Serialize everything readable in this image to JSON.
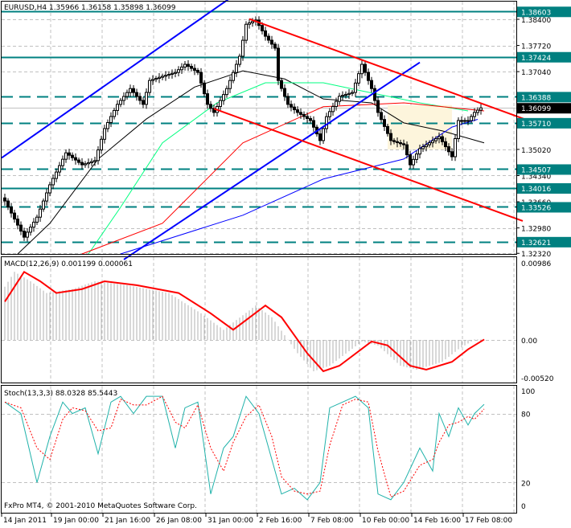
{
  "header": {
    "title": "EURUSD,H4  1.35966 1.36158 1.35898 1.36099"
  },
  "footer": {
    "copyright": "FxPro MT4, © 2001-2010 MetaQuotes Software Corp."
  },
  "colors": {
    "level": "#008080",
    "channel_blue": "#0000ff",
    "channel_red": "#ff0000",
    "ma_black": "#000000",
    "ma_green": "#00ff80",
    "ma_red": "#ff0000",
    "ma_blue": "#0000ff",
    "highlight": "#fdf5dc",
    "grid": "#c0c0c0"
  },
  "chart_data": [
    {
      "type": "candlestick",
      "title": "EURUSD,H4",
      "ohlc_last": {
        "open": 1.35966,
        "high": 1.36158,
        "low": 1.35898,
        "close": 1.36099
      },
      "ylim": [
        1.3215,
        1.388
      ],
      "y_ticks": [
        "1.38400",
        "1.37720",
        "1.37040",
        "1.35020",
        "1.34340",
        "1.33660",
        "1.32980",
        "1.32320"
      ],
      "x_ticks": [
        {
          "bar": 0,
          "label": "14 Jan 2011"
        },
        {
          "bar": 16,
          "label": "19 Jan 00:00"
        },
        {
          "bar": 32,
          "label": "21 Jan 16:00"
        },
        {
          "bar": 48,
          "label": "26 Jan 08:00"
        },
        {
          "bar": 64,
          "label": "31 Jan 00:00"
        },
        {
          "bar": 80,
          "label": "2 Feb 16:00"
        },
        {
          "bar": 96,
          "label": "7 Feb 08:00"
        },
        {
          "bar": 112,
          "label": "10 Feb 00:00"
        },
        {
          "bar": 128,
          "label": "14 Feb 16:00"
        },
        {
          "bar": 144,
          "label": "17 Feb 08:00"
        }
      ],
      "close_keypoints": [
        [
          1,
          1.3368
        ],
        [
          7,
          1.3274
        ],
        [
          11,
          1.3326
        ],
        [
          15,
          1.341
        ],
        [
          20,
          1.3493
        ],
        [
          25,
          1.3462
        ],
        [
          29,
          1.3473
        ],
        [
          32,
          1.3556
        ],
        [
          36,
          1.3619
        ],
        [
          40,
          1.366
        ],
        [
          44,
          1.3619
        ],
        [
          46,
          1.3681
        ],
        [
          50,
          1.3692
        ],
        [
          54,
          1.3702
        ],
        [
          57,
          1.3723
        ],
        [
          61,
          1.3702
        ],
        [
          64,
          1.3619
        ],
        [
          66,
          1.3598
        ],
        [
          70,
          1.366
        ],
        [
          74,
          1.3744
        ],
        [
          76,
          1.3827
        ],
        [
          79,
          1.3838
        ],
        [
          82,
          1.3796
        ],
        [
          85,
          1.3765
        ],
        [
          86,
          1.3681
        ],
        [
          89,
          1.3619
        ],
        [
          92,
          1.3598
        ],
        [
          96,
          1.3577
        ],
        [
          99,
          1.3525
        ],
        [
          101,
          1.3587
        ],
        [
          105,
          1.364
        ],
        [
          109,
          1.365
        ],
        [
          112,
          1.3723
        ],
        [
          115,
          1.366
        ],
        [
          117,
          1.3598
        ],
        [
          121,
          1.3525
        ],
        [
          125,
          1.3514
        ],
        [
          127,
          1.3462
        ],
        [
          130,
          1.3504
        ],
        [
          132,
          1.3514
        ],
        [
          136,
          1.3535
        ],
        [
          140,
          1.3483
        ],
        [
          142,
          1.3577
        ],
        [
          145,
          1.3577
        ],
        [
          147,
          1.3598
        ],
        [
          149,
          1.36099
        ]
      ],
      "levels": [
        {
          "price": "1.38603",
          "style": "solid"
        },
        {
          "price": "1.37424",
          "style": "solid"
        },
        {
          "price": "1.36388",
          "style": "dashed"
        },
        {
          "price": "1.35710",
          "style": "dashed"
        },
        {
          "price": "1.34507",
          "style": "dashed"
        },
        {
          "price": "1.34016",
          "style": "solid"
        },
        {
          "price": "1.33526",
          "style": "dashed"
        },
        {
          "price": "1.32621",
          "style": "dashed"
        }
      ],
      "current_price": "1.36099",
      "moving_averages": [
        {
          "name": "MA black",
          "color": "#000000",
          "points": [
            [
              5,
              1.3216
            ],
            [
              15,
              1.331
            ],
            [
              30,
              1.3477
            ],
            [
              45,
              1.3581
            ],
            [
              60,
              1.3664
            ],
            [
              75,
              1.3706
            ],
            [
              88,
              1.3685
            ],
            [
              100,
              1.3633
            ],
            [
              115,
              1.3623
            ],
            [
              125,
              1.3571
            ],
            [
              137,
              1.355
            ],
            [
              150,
              1.3519
            ]
          ]
        },
        {
          "name": "MA green",
          "color": "#00ff80",
          "points": [
            [
              27,
              1.3216
            ],
            [
              37,
              1.3352
            ],
            [
              50,
              1.3519
            ],
            [
              67,
              1.3623
            ],
            [
              82,
              1.3675
            ],
            [
              100,
              1.3675
            ],
            [
              112,
              1.3654
            ],
            [
              130,
              1.3623
            ],
            [
              145,
              1.3602
            ]
          ]
        },
        {
          "name": "MA red",
          "color": "#ff0000",
          "points": [
            [
              25,
              1.3216
            ],
            [
              50,
              1.331
            ],
            [
              75,
              1.3519
            ],
            [
              100,
              1.3613
            ],
            [
              125,
              1.3623
            ],
            [
              150,
              1.3602
            ]
          ]
        },
        {
          "name": "MA blue",
          "color": "#0000ff",
          "points": [
            [
              37,
              1.3216
            ],
            [
              75,
              1.3331
            ],
            [
              100,
              1.3425
            ],
            [
              125,
              1.3477
            ],
            [
              140,
              1.356
            ],
            [
              148,
              1.358
            ]
          ]
        }
      ],
      "trendlines": [
        {
          "name": "blue-channel-upper",
          "color": "#0000ff",
          "from": [
            0,
            1.348
          ],
          "to": [
            77,
            1.393
          ]
        },
        {
          "name": "blue-channel-lower",
          "color": "#0000ff",
          "from": [
            38,
            1.3216
          ],
          "to": [
            130,
            1.3728
          ]
        },
        {
          "name": "red-channel-upper",
          "color": "#ff0000",
          "from": [
            77,
            1.3841
          ],
          "to": [
            168,
            1.3564
          ]
        },
        {
          "name": "red-channel-lower",
          "color": "#ff0000",
          "from": [
            66,
            1.3608
          ],
          "to": [
            162,
            1.3316
          ]
        }
      ],
      "highlight_box": {
        "from_bar": 120,
        "to_bar": 140,
        "high": 1.3617,
        "low": 1.3502
      }
    },
    {
      "type": "line",
      "title": "MACD(12,26,9) 0.001199 0.000061",
      "ylim": [
        -0.0052,
        0.00986
      ],
      "y_ticks": [
        "0.00986",
        "0.00",
        "-0.00520"
      ],
      "signal_points": [
        [
          1,
          0.0049
        ],
        [
          7,
          0.0087
        ],
        [
          12,
          0.0075
        ],
        [
          17,
          0.006
        ],
        [
          25,
          0.0065
        ],
        [
          32,
          0.0075
        ],
        [
          42,
          0.007
        ],
        [
          55,
          0.006
        ],
        [
          65,
          0.0034
        ],
        [
          72,
          0.0013
        ],
        [
          82,
          0.0044
        ],
        [
          87,
          0.0029
        ],
        [
          95,
          -0.0017
        ],
        [
          100,
          -0.004
        ],
        [
          105,
          -0.0033
        ],
        [
          115,
          -0.0002
        ],
        [
          120,
          -0.0007
        ],
        [
          127,
          -0.0033
        ],
        [
          132,
          -0.0038
        ],
        [
          140,
          -0.0028
        ],
        [
          145,
          -0.0012
        ],
        [
          150,
          6e-05
        ]
      ]
    },
    {
      "type": "line",
      "title": "Stoch(13,3,3) 88.0328 85.5443",
      "ylim": [
        0,
        100
      ],
      "y_ticks": [
        "100",
        "80",
        "20",
        "0"
      ],
      "main_points": [
        [
          1,
          90
        ],
        [
          6,
          80
        ],
        [
          11,
          20
        ],
        [
          15,
          60
        ],
        [
          19,
          90
        ],
        [
          22,
          80
        ],
        [
          26,
          85
        ],
        [
          30,
          45
        ],
        [
          34,
          90
        ],
        [
          37,
          95
        ],
        [
          41,
          80
        ],
        [
          45,
          95
        ],
        [
          50,
          95
        ],
        [
          54,
          50
        ],
        [
          57,
          85
        ],
        [
          61,
          90
        ],
        [
          65,
          10
        ],
        [
          69,
          50
        ],
        [
          72,
          60
        ],
        [
          76,
          95
        ],
        [
          80,
          80
        ],
        [
          84,
          40
        ],
        [
          87,
          10
        ],
        [
          91,
          15
        ],
        [
          95,
          5
        ],
        [
          99,
          20
        ],
        [
          102,
          85
        ],
        [
          106,
          90
        ],
        [
          110,
          95
        ],
        [
          114,
          85
        ],
        [
          117,
          10
        ],
        [
          121,
          5
        ],
        [
          125,
          20
        ],
        [
          130,
          50
        ],
        [
          134,
          30
        ],
        [
          136,
          80
        ],
        [
          139,
          60
        ],
        [
          142,
          85
        ],
        [
          145,
          70
        ],
        [
          147,
          80
        ],
        [
          150,
          88
        ]
      ]
    }
  ]
}
